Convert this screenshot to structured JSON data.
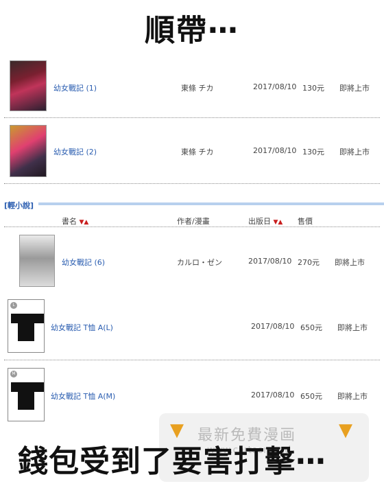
{
  "headline": "順帶⋯",
  "caption": "錢包受到了要害打擊⋯",
  "watermark": {
    "text": "最新免費漫画",
    "sub": "www.cartoonmad"
  },
  "section": {
    "label": "[輕小說]"
  },
  "table_header": {
    "title": "書名",
    "author": "作者/漫畫",
    "date": "出版日",
    "price": "售價",
    "sort_arrows": "▼▲"
  },
  "items": [
    {
      "title": "幼女戰記 (1)",
      "author": "東條 チカ",
      "date": "2017/08/10",
      "price": "130元",
      "status": "即將上市"
    },
    {
      "title": "幼女戰記 (2)",
      "author": "東條 チカ",
      "date": "2017/08/10",
      "price": "130元",
      "status": "即將上市"
    },
    {
      "title": "幼女戰記 (6)",
      "author": "カルロ・ゼン",
      "date": "2017/08/10",
      "price": "270元",
      "status": "即將上市"
    },
    {
      "title": "幼女戰記 T恤 A(L)",
      "author": "",
      "date": "2017/08/10",
      "price": "650元",
      "status": "即將上市",
      "size": "L"
    },
    {
      "title": "幼女戰記 T恤 A(M)",
      "author": "",
      "date": "2017/08/10",
      "price": "650元",
      "status": "即將上市",
      "size": "M"
    }
  ],
  "icons": {
    "watermark_hand": "pointing-down-hand-icon"
  }
}
